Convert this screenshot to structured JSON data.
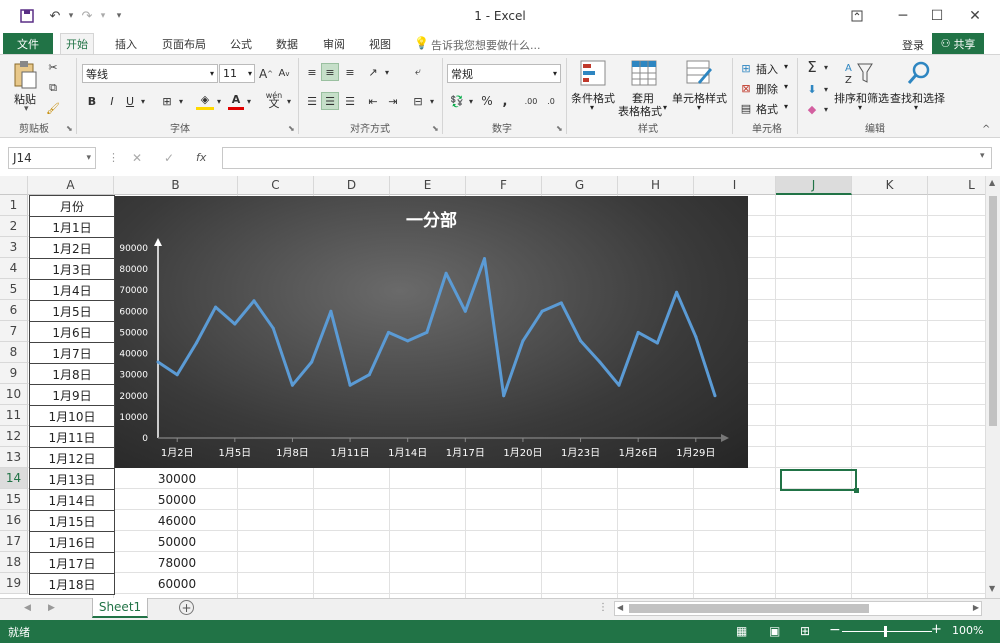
{
  "window": {
    "title": "1 - Excel"
  },
  "qat": {
    "save_icon": "save-icon",
    "undo_icon": "undo-icon",
    "redo_icon": "redo-icon"
  },
  "tabs": [
    {
      "label": "文件"
    },
    {
      "label": "开始"
    },
    {
      "label": "插入"
    },
    {
      "label": "页面布局"
    },
    {
      "label": "公式"
    },
    {
      "label": "数据"
    },
    {
      "label": "审阅"
    },
    {
      "label": "视图"
    }
  ],
  "tell_me": "告诉我您想要做什么...",
  "login": "登录",
  "share": "共享",
  "ribbon": {
    "paste": "粘贴",
    "font_name": "等线",
    "font_size": "11",
    "number_format": "常规",
    "cond_format": "条件格式",
    "table_format_1": "套用",
    "table_format_2": "表格格式",
    "cell_style": "单元格样式",
    "insert": "插入",
    "delete": "删除",
    "format": "格式",
    "sort_filter": "排序和筛选",
    "find_select": "查找和选择",
    "wen": "wén",
    "groups": {
      "clipboard": "剪贴板",
      "font": "字体",
      "align": "对齐方式",
      "number": "数字",
      "styles": "样式",
      "cells": "单元格",
      "edit": "编辑"
    }
  },
  "formula_bar": {
    "name_box": "J14",
    "fx": "fx",
    "value": ""
  },
  "columns": [
    "A",
    "B",
    "C",
    "D",
    "E",
    "F",
    "G",
    "H",
    "I",
    "J",
    "K",
    "L"
  ],
  "rows": [
    "1",
    "2",
    "3",
    "4",
    "5",
    "6",
    "7",
    "8",
    "9",
    "10",
    "11",
    "12",
    "13",
    "14",
    "15",
    "16",
    "17",
    "18",
    "19"
  ],
  "colA": [
    "月份",
    "1月1日",
    "1月2日",
    "1月3日",
    "1月4日",
    "1月5日",
    "1月6日",
    "1月7日",
    "1月8日",
    "1月9日",
    "1月10日",
    "1月11日",
    "1月12日",
    "1月13日",
    "1月14日",
    "1月15日",
    "1月16日",
    "1月17日",
    "1月18日"
  ],
  "colB_visible": {
    "14": "30000",
    "15": "50000",
    "16": "46000",
    "17": "50000",
    "18": "78000",
    "19": "60000"
  },
  "sheet": {
    "name": "Sheet1",
    "add_icon": "plus-icon"
  },
  "status": {
    "ready": "就绪",
    "zoom": "100%"
  },
  "chart_data": {
    "type": "line",
    "title": "一分部",
    "xlabel": "",
    "ylabel": "",
    "ylim": [
      0,
      90000
    ],
    "yticks": [
      "0",
      "10000",
      "20000",
      "30000",
      "40000",
      "50000",
      "60000",
      "70000",
      "80000",
      "90000"
    ],
    "xticks": [
      "1月2日",
      "1月5日",
      "1月8日",
      "1月11日",
      "1月14日",
      "1月17日",
      "1月20日",
      "1月23日",
      "1月26日",
      "1月29日"
    ],
    "x": [
      "1月1日",
      "1月2日",
      "1月3日",
      "1月4日",
      "1月5日",
      "1月6日",
      "1月7日",
      "1月8日",
      "1月9日",
      "1月10日",
      "1月11日",
      "1月12日",
      "1月13日",
      "1月14日",
      "1月15日",
      "1月16日",
      "1月17日",
      "1月18日",
      "1月19日",
      "1月20日",
      "1月21日",
      "1月22日",
      "1月23日",
      "1月24日",
      "1月25日",
      "1月26日",
      "1月27日",
      "1月28日",
      "1月29日",
      "1月30日",
      "1月31日"
    ],
    "series": [
      {
        "values": [
          36000,
          30000,
          45000,
          62000,
          54000,
          65000,
          52000,
          25000,
          36000,
          60000,
          25000,
          30000,
          50000,
          46000,
          50000,
          78000,
          60000,
          85000,
          20000,
          46000,
          60000,
          64000,
          46000,
          36000,
          25000,
          50000,
          45000,
          69000,
          48000,
          20000
        ],
        "color": "#5b9bd5"
      }
    ],
    "grid": false,
    "background": "dark"
  }
}
